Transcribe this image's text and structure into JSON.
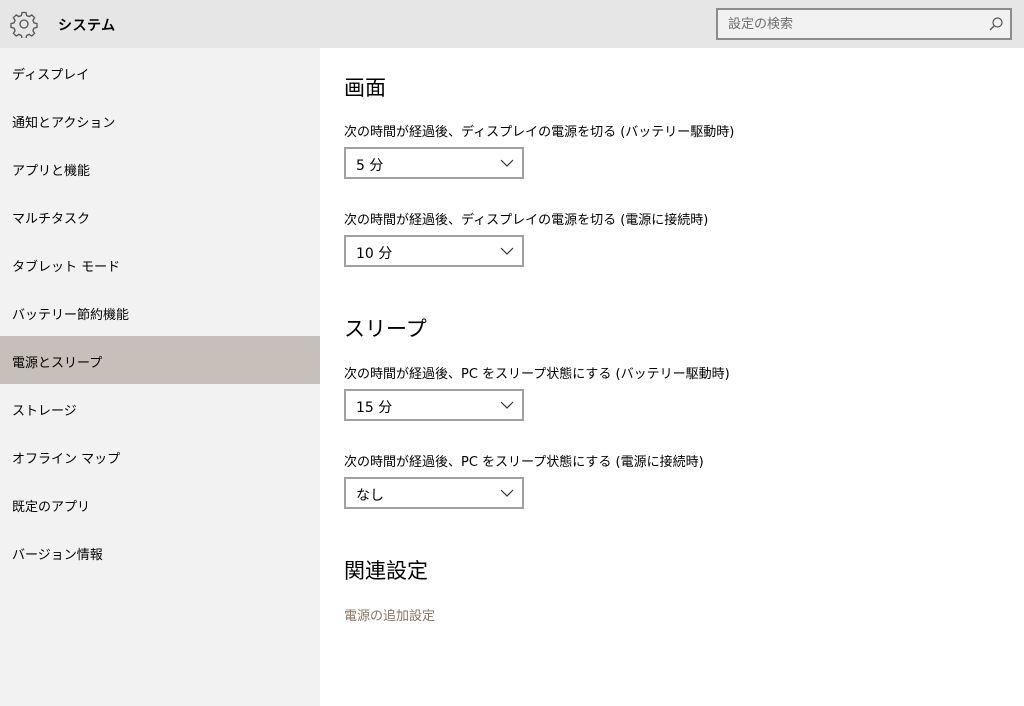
{
  "window": {
    "title": "システム",
    "search_placeholder": "設定の検索"
  },
  "sidebar": {
    "items": [
      {
        "label": "ディスプレイ",
        "selected": false
      },
      {
        "label": "通知とアクション",
        "selected": false
      },
      {
        "label": "アプリと機能",
        "selected": false
      },
      {
        "label": "マルチタスク",
        "selected": false
      },
      {
        "label": "タブレット モード",
        "selected": false
      },
      {
        "label": "バッテリー節約機能",
        "selected": false
      },
      {
        "label": "電源とスリープ",
        "selected": true
      },
      {
        "label": "ストレージ",
        "selected": false
      },
      {
        "label": "オフライン マップ",
        "selected": false
      },
      {
        "label": "既定のアプリ",
        "selected": false
      },
      {
        "label": "バージョン情報",
        "selected": false
      }
    ]
  },
  "screen": {
    "heading": "画面",
    "battery_label": "次の時間が経過後、ディスプレイの電源を切る (バッテリー駆動時)",
    "battery_value": "5 分",
    "plugged_label": "次の時間が経過後、ディスプレイの電源を切る (電源に接続時)",
    "plugged_value": "10 分"
  },
  "sleep": {
    "heading": "スリープ",
    "battery_label": "次の時間が経過後、PC をスリープ状態にする (バッテリー駆動時)",
    "battery_value": "15 分",
    "plugged_label": "次の時間が経過後、PC をスリープ状態にする (電源に接続時)",
    "plugged_value": "なし"
  },
  "related": {
    "heading": "関連設定",
    "link": "電源の追加設定"
  },
  "colors": {
    "selected_nav": "#c6c0b8",
    "link": "#867560",
    "sidebar_bg": "#f2f2f2",
    "titlebar_bg": "#e6e6e6"
  }
}
